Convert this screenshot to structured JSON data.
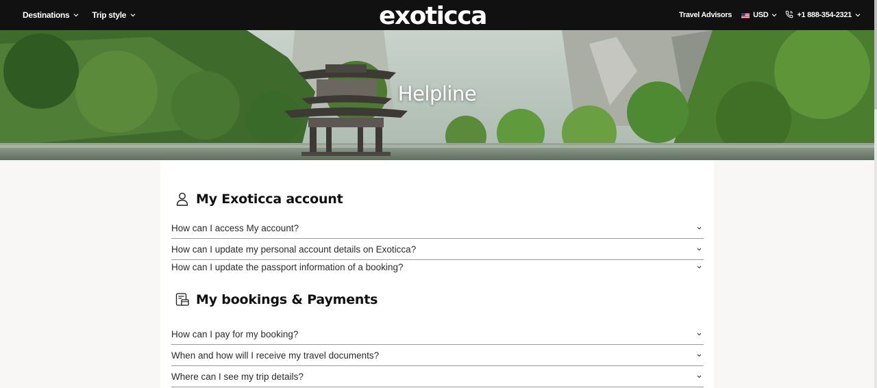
{
  "header": {
    "nav_left": [
      {
        "label": "Destinations"
      },
      {
        "label": "Trip style"
      }
    ],
    "logo_text": "exoticca",
    "travel_advisors": "Travel Advisors",
    "currency": "USD",
    "phone": "+1 888-354-2321",
    "icons": {
      "flag": "us-flag-icon",
      "phone": "phone-icon",
      "chevron": "chevron-down-icon"
    }
  },
  "hero": {
    "title": "Helpline"
  },
  "sections": [
    {
      "title": "My Exoticca account",
      "icon": "user-icon",
      "questions": [
        "How can I access My account?",
        "How can I update my personal account details on Exoticca?",
        "How can I update the passport information of a booking?"
      ]
    },
    {
      "title": "My bookings & Payments",
      "icon": "booking-card-icon",
      "questions": [
        "How can I pay for my booking?",
        "When and how will I receive my travel documents?",
        "Where can I see my trip details?"
      ]
    }
  ],
  "colors": {
    "topbar": "#111111",
    "page_bg": "#f8f7f5",
    "card_bg": "#ffffff",
    "divider": "#9a9a9a"
  }
}
